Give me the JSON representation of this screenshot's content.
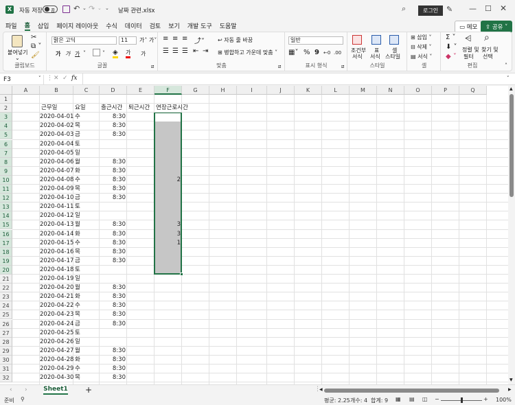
{
  "titlebar": {
    "autosave_label": "자동 저장",
    "autosave_state": "끔",
    "filename": "날짜 관련.xlsx",
    "login_label": "로그인"
  },
  "menu": [
    "파일",
    "홈",
    "삽입",
    "페이지 레이아웃",
    "수식",
    "데이터",
    "검토",
    "보기",
    "개발 도구",
    "도움말"
  ],
  "menu_active_index": 1,
  "menu_right": {
    "comment": "메모",
    "share": "공유"
  },
  "ribbon": {
    "clipboard": {
      "paste": "붙여넣기",
      "label": "클립보드"
    },
    "font": {
      "name": "맑은 고딕",
      "size": "11",
      "label": "글꼴",
      "bold": "가",
      "italic": "가",
      "underline": "가",
      "grow": "가˄",
      "shrink": "가˅",
      "color_letter": "가",
      "ga": "가"
    },
    "align": {
      "wrap": "자동 줄 바꿈",
      "merge": "병합하고 가운데 맞춤",
      "label": "맞춤"
    },
    "number": {
      "format": "일반",
      "label": "표시 형식"
    },
    "styles": {
      "conditional": "조건부",
      "conditional2": "서식",
      "table": "표",
      "table2": "서식",
      "cell": "셀",
      "cell2": "스타일",
      "label": "스타일"
    },
    "cells": {
      "insert": "삽입",
      "delete": "삭제",
      "format": "서식",
      "label": "셀"
    },
    "editing": {
      "sort": "정렬 및",
      "sort2": "필터",
      "find": "찾기 및",
      "find2": "선택",
      "label": "편집"
    }
  },
  "formula": {
    "namebox": "F3",
    "value": ""
  },
  "columns": [
    "A",
    "B",
    "C",
    "D",
    "E",
    "F",
    "G",
    "H",
    "I",
    "J",
    "K",
    "L",
    "M",
    "N",
    "O",
    "P",
    "Q"
  ],
  "selected_column": "F",
  "headers_row2": {
    "b": "근무일",
    "c": "요일",
    "d": "출근시간",
    "e": "퇴근시간",
    "f": "연장근로시간"
  },
  "rows": [
    {
      "n": "1",
      "date": "",
      "day": "",
      "in": "",
      "ot": ""
    },
    {
      "n": "2",
      "date": "",
      "day": "",
      "in": "",
      "ot": ""
    },
    {
      "n": "3",
      "date": "2020-04-01",
      "day": "수",
      "in": "8:30",
      "ot": ""
    },
    {
      "n": "4",
      "date": "2020-04-02",
      "day": "목",
      "in": "8:30",
      "ot": ""
    },
    {
      "n": "5",
      "date": "2020-04-03",
      "day": "금",
      "in": "8:30",
      "ot": ""
    },
    {
      "n": "6",
      "date": "2020-04-04",
      "day": "토",
      "in": "",
      "ot": ""
    },
    {
      "n": "7",
      "date": "2020-04-05",
      "day": "일",
      "in": "",
      "ot": ""
    },
    {
      "n": "8",
      "date": "2020-04-06",
      "day": "월",
      "in": "8:30",
      "ot": ""
    },
    {
      "n": "9",
      "date": "2020-04-07",
      "day": "화",
      "in": "8:30",
      "ot": ""
    },
    {
      "n": "10",
      "date": "2020-04-08",
      "day": "수",
      "in": "8:30",
      "ot": "2"
    },
    {
      "n": "11",
      "date": "2020-04-09",
      "day": "목",
      "in": "8:30",
      "ot": ""
    },
    {
      "n": "12",
      "date": "2020-04-10",
      "day": "금",
      "in": "8:30",
      "ot": ""
    },
    {
      "n": "13",
      "date": "2020-04-11",
      "day": "토",
      "in": "",
      "ot": ""
    },
    {
      "n": "14",
      "date": "2020-04-12",
      "day": "일",
      "in": "",
      "ot": ""
    },
    {
      "n": "15",
      "date": "2020-04-13",
      "day": "월",
      "in": "8:30",
      "ot": "3"
    },
    {
      "n": "16",
      "date": "2020-04-14",
      "day": "화",
      "in": "8:30",
      "ot": "3"
    },
    {
      "n": "17",
      "date": "2020-04-15",
      "day": "수",
      "in": "8:30",
      "ot": "1"
    },
    {
      "n": "18",
      "date": "2020-04-16",
      "day": "목",
      "in": "8:30",
      "ot": ""
    },
    {
      "n": "19",
      "date": "2020-04-17",
      "day": "금",
      "in": "8:30",
      "ot": ""
    },
    {
      "n": "20",
      "date": "2020-04-18",
      "day": "토",
      "in": "",
      "ot": ""
    },
    {
      "n": "21",
      "date": "2020-04-19",
      "day": "일",
      "in": "",
      "ot": ""
    },
    {
      "n": "22",
      "date": "2020-04-20",
      "day": "월",
      "in": "8:30",
      "ot": ""
    },
    {
      "n": "23",
      "date": "2020-04-21",
      "day": "화",
      "in": "8:30",
      "ot": ""
    },
    {
      "n": "24",
      "date": "2020-04-22",
      "day": "수",
      "in": "8:30",
      "ot": ""
    },
    {
      "n": "25",
      "date": "2020-04-23",
      "day": "목",
      "in": "8:30",
      "ot": ""
    },
    {
      "n": "26",
      "date": "2020-04-24",
      "day": "금",
      "in": "8:30",
      "ot": ""
    },
    {
      "n": "27",
      "date": "2020-04-25",
      "day": "토",
      "in": "",
      "ot": ""
    },
    {
      "n": "28",
      "date": "2020-04-26",
      "day": "일",
      "in": "",
      "ot": ""
    },
    {
      "n": "29",
      "date": "2020-04-27",
      "day": "월",
      "in": "8:30",
      "ot": ""
    },
    {
      "n": "30",
      "date": "2020-04-28",
      "day": "화",
      "in": "8:30",
      "ot": ""
    },
    {
      "n": "31",
      "date": "2020-04-29",
      "day": "수",
      "in": "8:30",
      "ot": ""
    },
    {
      "n": "32",
      "date": "2020-04-30",
      "day": "목",
      "in": "8:30",
      "ot": ""
    }
  ],
  "sheets": [
    "Sheet1"
  ],
  "status": {
    "mode": "준비",
    "average": "평균: 2.25",
    "count": "개수: 4",
    "sum": "합계: 9",
    "zoom": "100%"
  },
  "colors": {
    "accent": "#217346",
    "selection_fill": "#c6c6c6"
  }
}
